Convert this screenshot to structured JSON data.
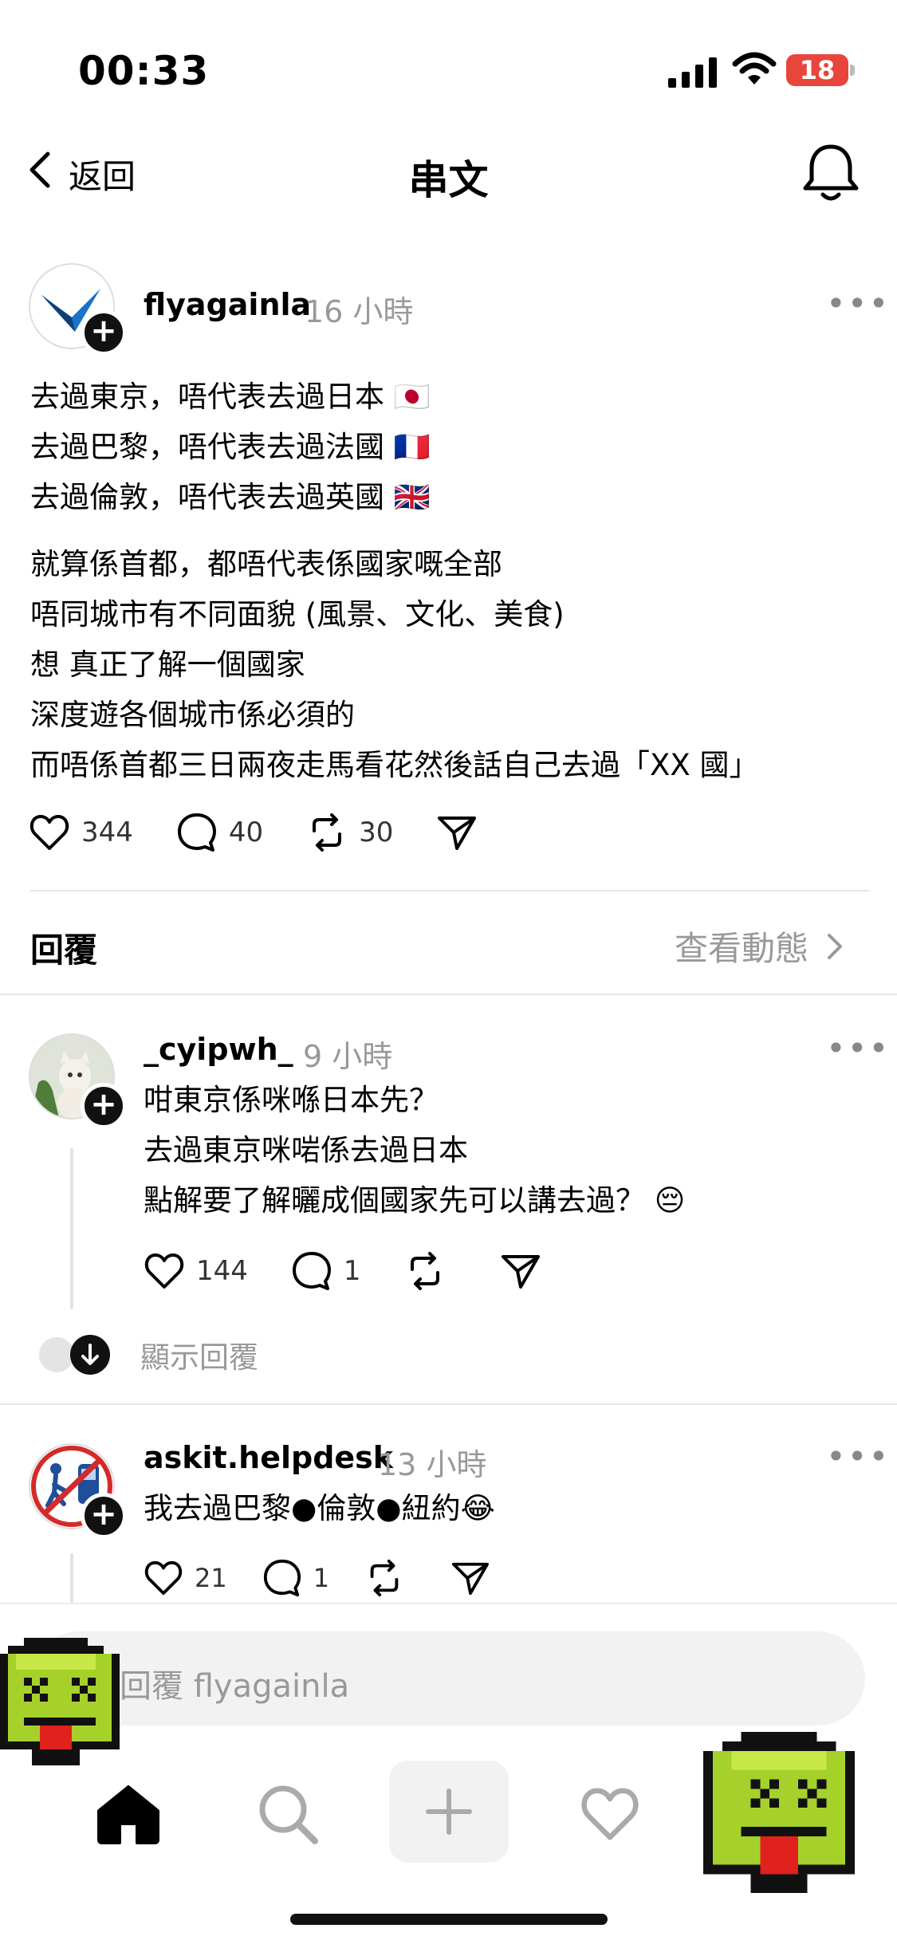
{
  "status_bar": {
    "time": "00:33",
    "battery": "18"
  },
  "header": {
    "back_label": "返回",
    "title": "串文"
  },
  "post": {
    "username": "flyagainla",
    "time": "16 小時",
    "text": "去過東京，唔代表去過日本 🇯🇵\n去過巴黎，唔代表去過法國 🇫🇷\n去過倫敦，唔代表去過英國 🇬🇧",
    "text2": "就算係首都，都唔代表係國家嘅全部\n唔同城市有不同面貌 (風景、文化、美食)\n想  真正了解一個國家\n  深度遊各個城市係必須的\n而唔係首都三日兩夜走馬看花然後話自己去過「XX 國」",
    "likes": "344",
    "comments": "40",
    "reposts": "30"
  },
  "replies_section": {
    "label": "回覆",
    "view_activity": "查看動態"
  },
  "replies": [
    {
      "username": "_cyipwh_",
      "time": "9 小時",
      "text": "咁東京係咪喺日本先？\n去過東京咪啱係去過日本\n點解要了解曬成個國家先可以講去過？ 😔",
      "likes": "144",
      "comments": "1",
      "show_replies": "顯示回覆"
    },
    {
      "username": "askit.helpdesk",
      "time": "13 小時",
      "text": "我去過巴黎●倫敦●紐約😂",
      "likes": "21",
      "comments": "1"
    }
  ],
  "composer": {
    "placeholder": "回覆 flyagainla"
  },
  "icons": {
    "back": "chevron-left-icon",
    "bell": "bell-icon",
    "like": "heart-icon",
    "comment": "comment-icon",
    "repost": "repost-icon",
    "share": "send-icon",
    "home": "home-icon",
    "search": "search-icon",
    "add": "plus-icon",
    "activity": "heart-icon"
  },
  "colors": {
    "battery": "#e8453c",
    "muted_text": "#999999",
    "logo_blue": "#1a73c9"
  }
}
